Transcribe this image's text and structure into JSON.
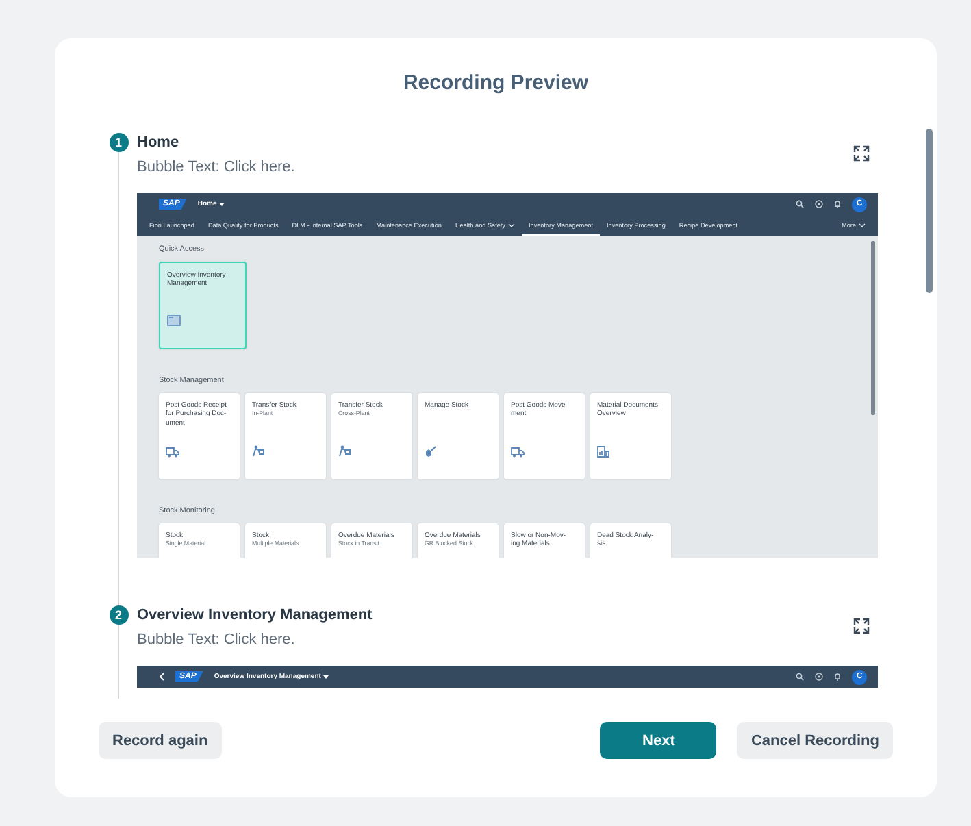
{
  "dialog": {
    "title": "Recording Preview"
  },
  "steps": [
    {
      "number": "1",
      "title": "Home",
      "bubble_text": "Bubble Text: Click here.",
      "screenshot": {
        "kind": "launchpad",
        "logo": "SAP",
        "app_title": "Home",
        "avatar": "C",
        "nav_tabs": [
          {
            "label": "Fiori Launchpad",
            "selected": false,
            "dropdown": false
          },
          {
            "label": "Data Quality for Products",
            "selected": false,
            "dropdown": false
          },
          {
            "label": "DLM - Internal SAP Tools",
            "selected": false,
            "dropdown": false
          },
          {
            "label": "Maintenance Execution",
            "selected": false,
            "dropdown": false
          },
          {
            "label": "Health and Safety",
            "selected": false,
            "dropdown": true
          },
          {
            "label": "Inventory Management",
            "selected": true,
            "dropdown": false
          },
          {
            "label": "Inventory Processing",
            "selected": false,
            "dropdown": false
          },
          {
            "label": "Recipe Development",
            "selected": false,
            "dropdown": false
          }
        ],
        "more": "More",
        "sections": [
          {
            "title": "Quick Access",
            "tiles": [
              {
                "title": "Overview Inventory\nManagement",
                "highlighted": true,
                "kind": "card"
              }
            ]
          },
          {
            "title": "Stock Management",
            "tiles": [
              {
                "title": "Post Goods Receipt\nfor Purchasing Doc-\nument",
                "highlighted": false,
                "kind": "truck"
              },
              {
                "title": "Transfer Stock",
                "subtitle": "In-Plant",
                "highlighted": false,
                "kind": "dolly"
              },
              {
                "title": "Transfer Stock",
                "subtitle": "Cross-Plant",
                "highlighted": false,
                "kind": "dolly"
              },
              {
                "title": "Manage Stock",
                "highlighted": false,
                "kind": "wrench"
              },
              {
                "title": "Post Goods Move-\nment",
                "highlighted": false,
                "kind": "truck"
              },
              {
                "title": "Material Documents\nOverview",
                "highlighted": false,
                "kind": "chart"
              }
            ]
          },
          {
            "title": "Stock Monitoring",
            "tiles": [
              {
                "title": "Stock",
                "subtitle": "Single Material",
                "highlighted": false
              },
              {
                "title": "Stock",
                "subtitle": "Multiple Materials",
                "highlighted": false
              },
              {
                "title": "Overdue Materials",
                "subtitle": "Stock in Transit",
                "highlighted": false
              },
              {
                "title": "Overdue Materials",
                "subtitle": "GR Blocked Stock",
                "highlighted": false
              },
              {
                "title": "Slow or Non-Mov-\ning Materials",
                "highlighted": false
              },
              {
                "title": "Dead Stock Analy-\nsis",
                "highlighted": false
              }
            ]
          }
        ]
      }
    },
    {
      "number": "2",
      "title": "Overview Inventory Management",
      "bubble_text": "Bubble Text: Click here.",
      "screenshot": {
        "kind": "app",
        "logo": "SAP",
        "app_title": "Overview Inventory Management",
        "avatar": "C"
      }
    }
  ],
  "buttons": [
    {
      "label": "Record again",
      "kind": "secondary"
    },
    {
      "label": "Next",
      "kind": "primary"
    },
    {
      "label": "Cancel Recording",
      "kind": "secondary"
    }
  ]
}
